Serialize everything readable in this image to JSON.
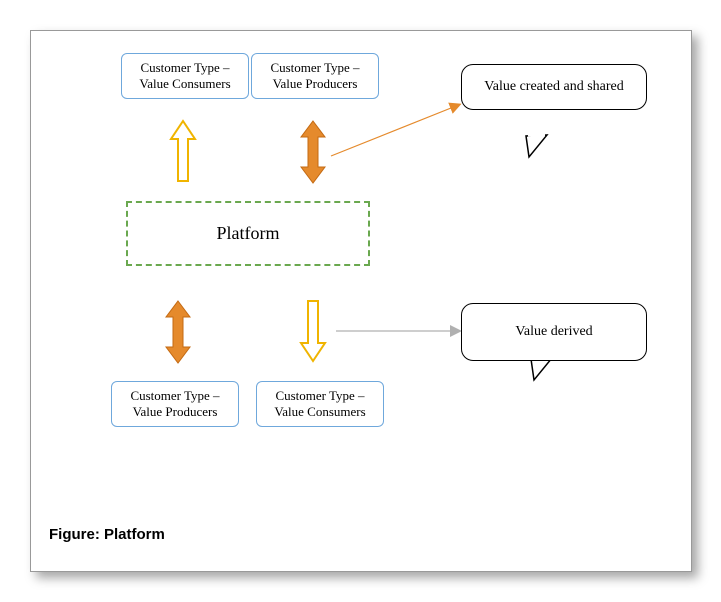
{
  "boxes": {
    "top_left": "Customer Type – Value Consumers",
    "top_right": "Customer Type – Value Producers",
    "bottom_left": "Customer Type – Value Producers",
    "bottom_right": "Customer Type – Value Consumers"
  },
  "center": "Platform",
  "callouts": {
    "top": "Value created and shared",
    "bottom": "Value derived"
  },
  "caption": "Figure: Platform"
}
